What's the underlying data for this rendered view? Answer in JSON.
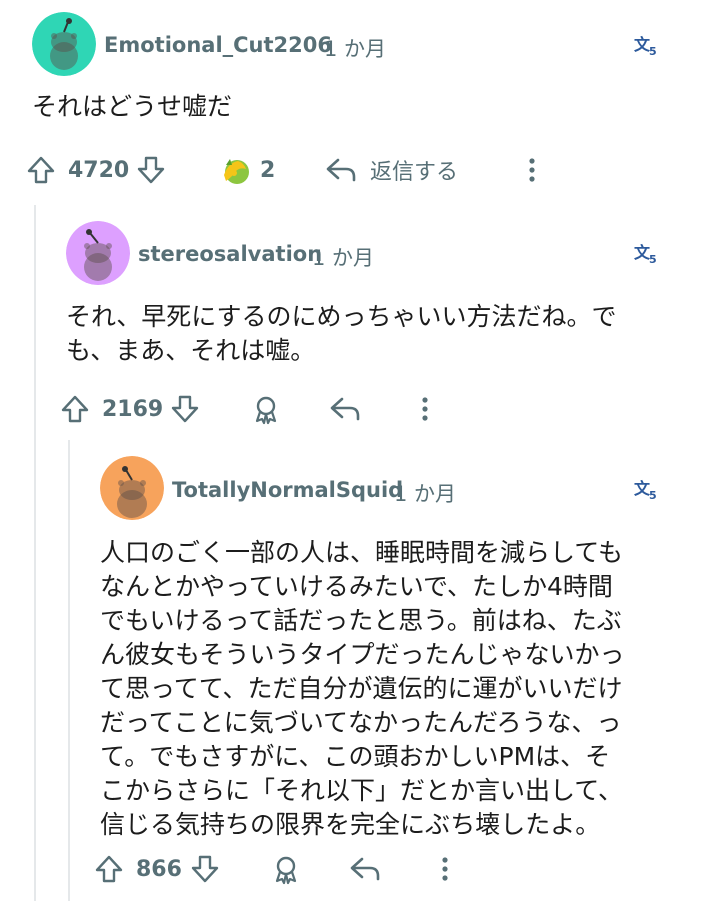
{
  "comments": [
    {
      "username": "Emotional_Cut2206",
      "time": "1 か月",
      "translate_icon": "translate-icon",
      "text": "それはどうせ嘘だ",
      "votes": "4720",
      "award_count": "2",
      "reply_label": "返信する",
      "avatar_color": "#2fd6b5"
    },
    {
      "username": "stereosalvation",
      "time": "1 か月",
      "translate_icon": "translate-icon",
      "text_lines": [
        "それ、早死にするのにめっちゃいい方法だね。で",
        "も、まあ、それは嘘。"
      ],
      "votes": "2169",
      "avatar_color": "#dda0ff"
    },
    {
      "username": "TotallyNormalSquid",
      "time": "1 か月",
      "translate_icon": "translate-icon",
      "text_lines": [
        "人口のごく一部の人は、睡眠時間を減らしても",
        "なんとかやっていけるみたいで、たしか4時間",
        "でもいけるって話だったと思う。前はね、たぶ",
        "ん彼女もそういうタイプだったんじゃないかっ",
        "て思ってて、ただ自分が遺伝的に運がいいだけ",
        "だってことに気づいてなかったんだろうな、っ",
        "て。でもさすがに、この頭おかしいPMは、そ",
        "こからさらに「それ以下」だとか言い出して、",
        "信じる気持ちの限界を完全にぶち壊したよ。"
      ],
      "votes": "866",
      "avatar_color": "#f7a35c"
    }
  ]
}
